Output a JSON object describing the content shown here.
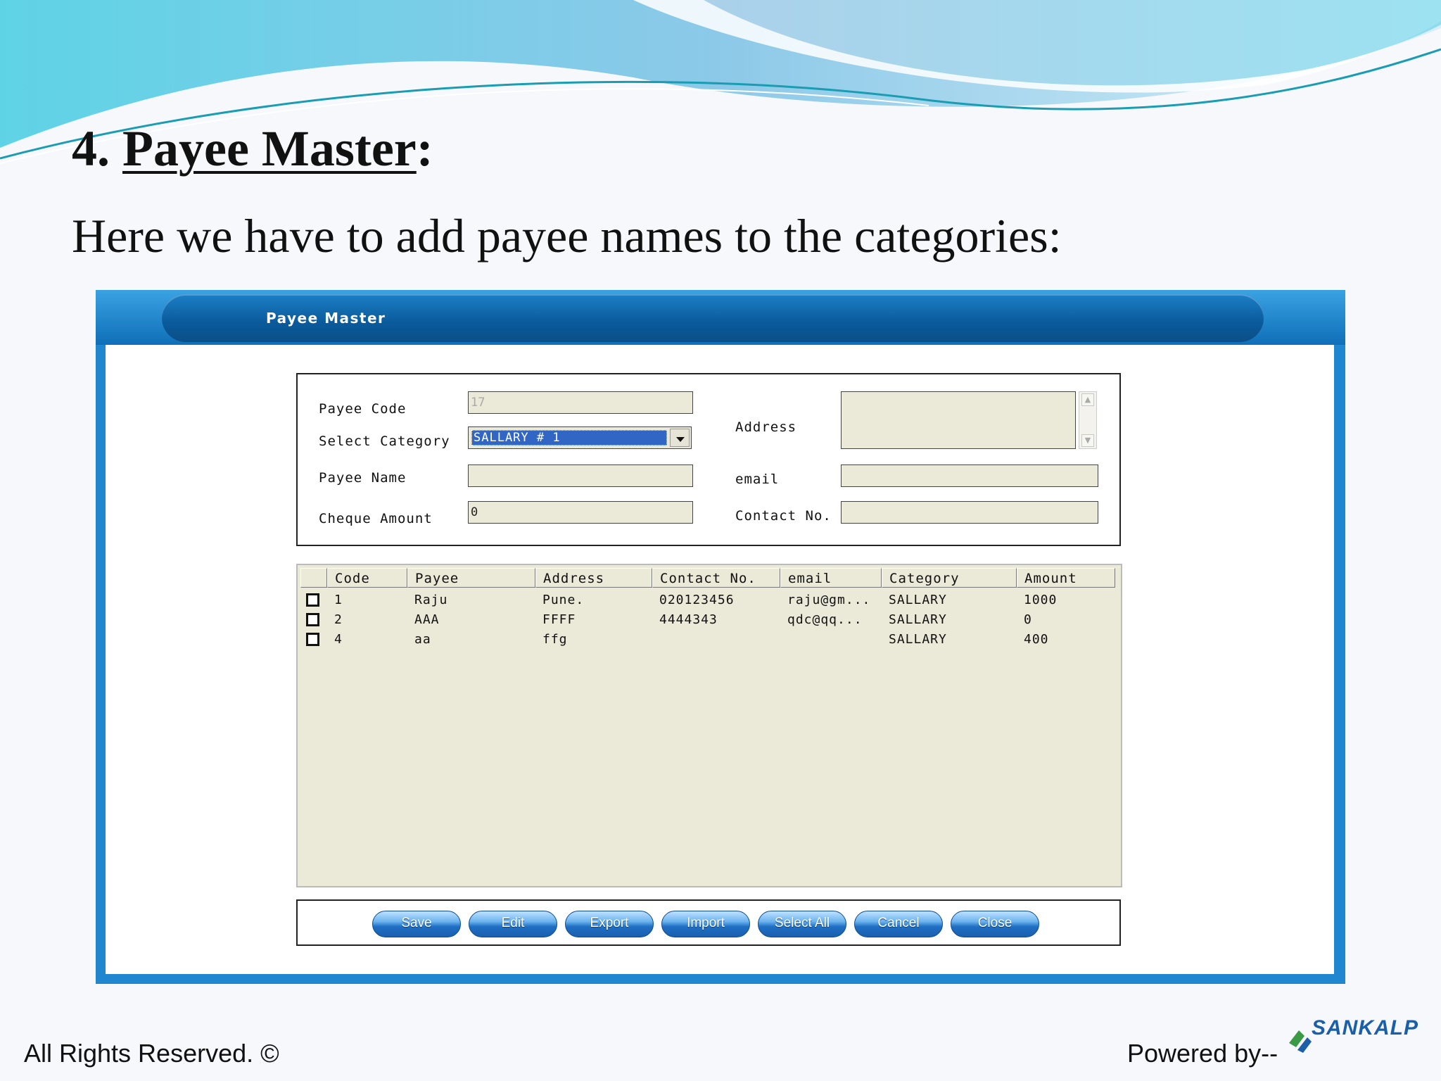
{
  "slide": {
    "number": "4. ",
    "title": "Payee Master",
    "title_suffix": ":",
    "subtitle": "Here we have to add payee names to the categories:",
    "footer_left": "All Rights Reserved. ©",
    "footer_right": "Powered by--",
    "logo_text": "SANKALP"
  },
  "window": {
    "title": "Payee Master"
  },
  "form": {
    "payee_code_label": "Payee Code",
    "payee_code_value": "17",
    "select_category_label": "Select Category",
    "select_category_value": "SALLARY # 1",
    "payee_name_label": "Payee Name",
    "payee_name_value": "",
    "cheque_amount_label": "Cheque Amount",
    "cheque_amount_value": "0",
    "address_label": "Address",
    "address_value": "",
    "email_label": "email",
    "email_value": "",
    "contact_label": "Contact No.",
    "contact_value": ""
  },
  "grid": {
    "columns": [
      "Code",
      "Payee",
      "Address",
      "Contact No.",
      "email",
      "Category",
      "Amount"
    ],
    "rows": [
      {
        "code": "1",
        "payee": "Raju",
        "address": "Pune.",
        "contact": "020123456",
        "email": "raju@gm...",
        "category": "SALLARY",
        "amount": "1000"
      },
      {
        "code": "2",
        "payee": "AAA",
        "address": "FFFF",
        "contact": "4444343",
        "email": "qdc@qq...",
        "category": "SALLARY",
        "amount": "0"
      },
      {
        "code": "4",
        "payee": "aa",
        "address": "ffg",
        "contact": "",
        "email": "",
        "category": "SALLARY",
        "amount": "400"
      }
    ]
  },
  "buttons": {
    "save": "Save",
    "edit": "Edit",
    "export": "Export",
    "import": "Import",
    "select_all": "Select All",
    "cancel": "Cancel",
    "close": "Close"
  },
  "colors": {
    "window_frame": "#1f86cf",
    "title_bar": "#0a5a9b",
    "field_bg": "#ebe9d8",
    "selection": "#3166c4",
    "button": "#1f6fc4"
  }
}
